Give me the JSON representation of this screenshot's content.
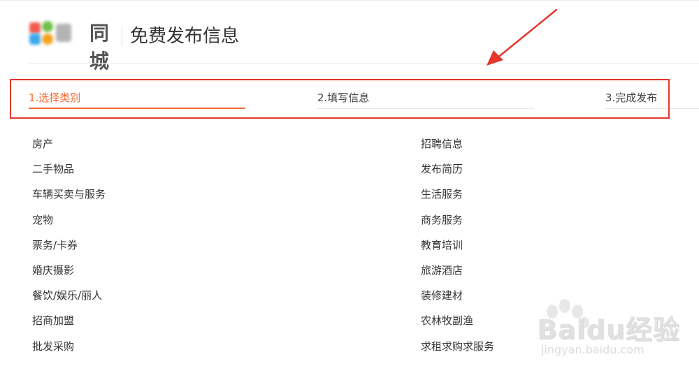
{
  "header": {
    "logo_text": "同城",
    "page_title": "免费发布信息"
  },
  "steps": [
    {
      "label": "1.选择类别",
      "active": true
    },
    {
      "label": "2.填写信息",
      "active": false
    },
    {
      "label": "3.完成发布",
      "active": false
    }
  ],
  "categories_left": [
    "房产",
    "二手物品",
    "车辆买卖与服务",
    "宠物",
    "票务/卡券",
    "婚庆摄影",
    "餐饮/娱乐/丽人",
    "招商加盟",
    "批发采购"
  ],
  "categories_right": [
    "招聘信息",
    "发布简历",
    "生活服务",
    "商务服务",
    "教育培训",
    "旅游酒店",
    "装修建材",
    "农林牧副渔",
    "求租求购求服务"
  ],
  "watermark": {
    "main": "Baidu经验",
    "sub": "jingyan.baidu.com"
  },
  "colors": {
    "accent": "#f46a2e",
    "annotation": "#e5362c"
  }
}
